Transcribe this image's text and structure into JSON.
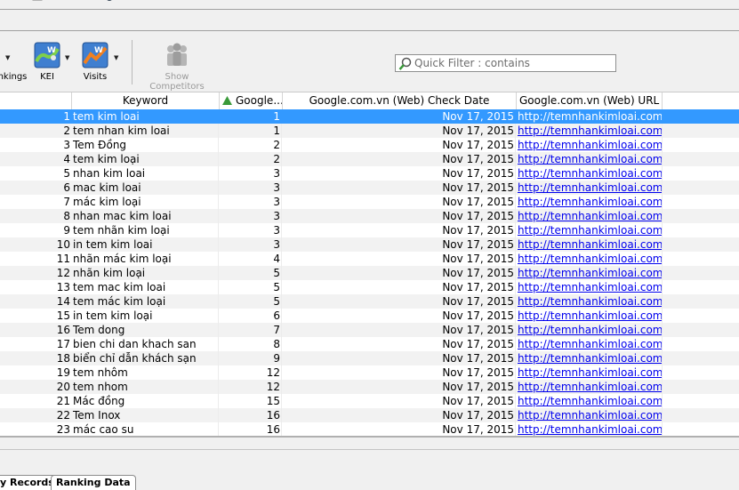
{
  "toolbar": {
    "rankings_label": "nkings",
    "kei_label": "KEI",
    "visits_label": "Visits",
    "competitors_label": "Show Competitors"
  },
  "filter": {
    "placeholder": "Quick Filter : contains"
  },
  "grid": {
    "columns": {
      "keyword": "Keyword",
      "rank": "Google....",
      "date": "Google.com.vn (Web) Check Date",
      "url": "Google.com.vn (Web) URL F..."
    },
    "rows": [
      {
        "n": "1",
        "kw": "tem kim loai",
        "rank": "1",
        "date": "Nov 17, 2015",
        "url": "http://temnhankimloai.com..."
      },
      {
        "n": "2",
        "kw": "tem nhan kim loai",
        "rank": "1",
        "date": "Nov 17, 2015",
        "url": "http://temnhankimloai.com..."
      },
      {
        "n": "3",
        "kw": "Tem Đồng",
        "rank": "2",
        "date": "Nov 17, 2015",
        "url": "http://temnhankimloai.com..."
      },
      {
        "n": "4",
        "kw": "tem kim loại",
        "rank": "2",
        "date": "Nov 17, 2015",
        "url": "http://temnhankimloai.com..."
      },
      {
        "n": "5",
        "kw": "nhan kim loai",
        "rank": "3",
        "date": "Nov 17, 2015",
        "url": "http://temnhankimloai.com..."
      },
      {
        "n": "6",
        "kw": "mac kim loai",
        "rank": "3",
        "date": "Nov 17, 2015",
        "url": "http://temnhankimloai.com..."
      },
      {
        "n": "7",
        "kw": "mác kim loại",
        "rank": "3",
        "date": "Nov 17, 2015",
        "url": "http://temnhankimloai.com..."
      },
      {
        "n": "8",
        "kw": "nhan mac kim loai",
        "rank": "3",
        "date": "Nov 17, 2015",
        "url": "http://temnhankimloai.com..."
      },
      {
        "n": "9",
        "kw": "tem nhãn kim loại",
        "rank": "3",
        "date": "Nov 17, 2015",
        "url": "http://temnhankimloai.com..."
      },
      {
        "n": "10",
        "kw": "in tem kim loai",
        "rank": "3",
        "date": "Nov 17, 2015",
        "url": "http://temnhankimloai.com..."
      },
      {
        "n": "11",
        "kw": "nhãn mác kim loại",
        "rank": "4",
        "date": "Nov 17, 2015",
        "url": "http://temnhankimloai.com..."
      },
      {
        "n": "12",
        "kw": "nhãn kim loại",
        "rank": "5",
        "date": "Nov 17, 2015",
        "url": "http://temnhankimloai.com..."
      },
      {
        "n": "13",
        "kw": "tem mac kim loai",
        "rank": "5",
        "date": "Nov 17, 2015",
        "url": "http://temnhankimloai.com..."
      },
      {
        "n": "14",
        "kw": "tem mác kim loại",
        "rank": "5",
        "date": "Nov 17, 2015",
        "url": "http://temnhankimloai.com..."
      },
      {
        "n": "15",
        "kw": "in tem kim loại",
        "rank": "6",
        "date": "Nov 17, 2015",
        "url": "http://temnhankimloai.com..."
      },
      {
        "n": "16",
        "kw": "Tem dong",
        "rank": "7",
        "date": "Nov 17, 2015",
        "url": "http://temnhankimloai.com..."
      },
      {
        "n": "17",
        "kw": "bien chi dan khach san",
        "rank": "8",
        "date": "Nov 17, 2015",
        "url": "http://temnhankimloai.com..."
      },
      {
        "n": "18",
        "kw": "biển chỉ dẫn khách sạn",
        "rank": "9",
        "date": "Nov 17, 2015",
        "url": "http://temnhankimloai.com..."
      },
      {
        "n": "19",
        "kw": "tem nhôm",
        "rank": "12",
        "date": "Nov 17, 2015",
        "url": "http://temnhankimloai.com..."
      },
      {
        "n": "20",
        "kw": "tem nhom",
        "rank": "12",
        "date": "Nov 17, 2015",
        "url": "http://temnhankimloai.com..."
      },
      {
        "n": "21",
        "kw": "Mác đồng",
        "rank": "15",
        "date": "Nov 17, 2015",
        "url": "http://temnhankimloai.com..."
      },
      {
        "n": "22",
        "kw": "Tem Inox",
        "rank": "16",
        "date": "Nov 17, 2015",
        "url": "http://temnhankimloai.com..."
      },
      {
        "n": "23",
        "kw": "mác cao su",
        "rank": "16",
        "date": "Nov 17, 2015",
        "url": "http://temnhankimloai.com..."
      }
    ]
  },
  "tabs": {
    "records": "y Records",
    "ranking": "Ranking Data"
  },
  "colors": {
    "selection": "#3399ff",
    "link": "#0000ee",
    "sort_arrow": "#3a9a3a"
  }
}
